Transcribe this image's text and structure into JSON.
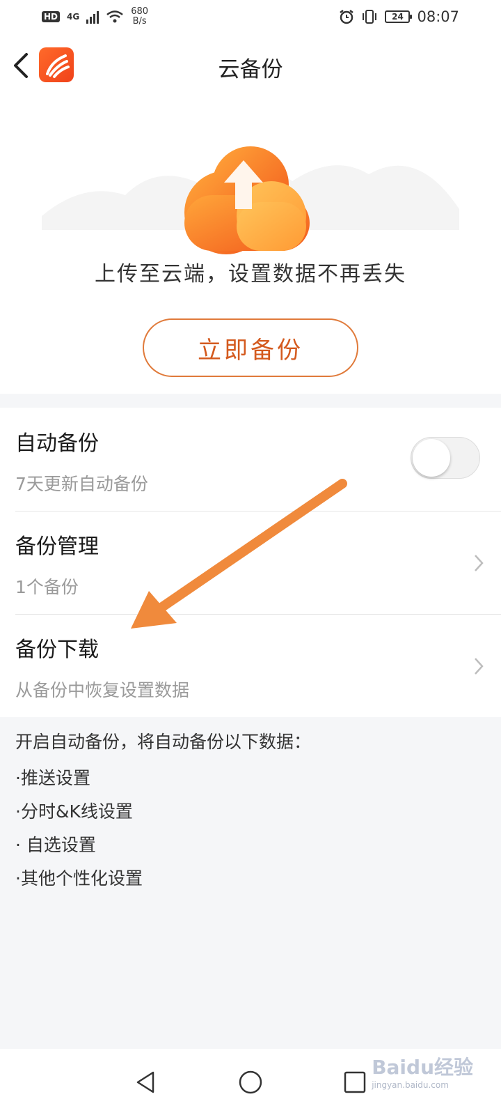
{
  "status_bar": {
    "hd": "HD",
    "network": "4G",
    "speed_value": "680",
    "speed_unit": "B/s",
    "battery": "24",
    "time": "08:07"
  },
  "header": {
    "title": "云备份"
  },
  "hero": {
    "tagline": "上传至云端，设置数据不再丢失",
    "backup_button": "立即备份"
  },
  "settings": {
    "auto_backup": {
      "title": "自动备份",
      "subtitle": "7天更新自动备份",
      "enabled": false
    },
    "backup_manage": {
      "title": "备份管理",
      "subtitle": "1个备份"
    },
    "backup_download": {
      "title": "备份下载",
      "subtitle": "从备份中恢复设置数据"
    }
  },
  "info": {
    "heading": "开启自动备份，将自动备份以下数据：",
    "items": [
      "·推送设置",
      "·分时&K线设置",
      "· 自选设置",
      "·其他个性化设置"
    ]
  },
  "watermark": {
    "brand": "Baidu经验",
    "url": "jingyan.baidu.com"
  },
  "colors": {
    "accent": "#d45a1e",
    "annotation": "#f08a3c"
  }
}
